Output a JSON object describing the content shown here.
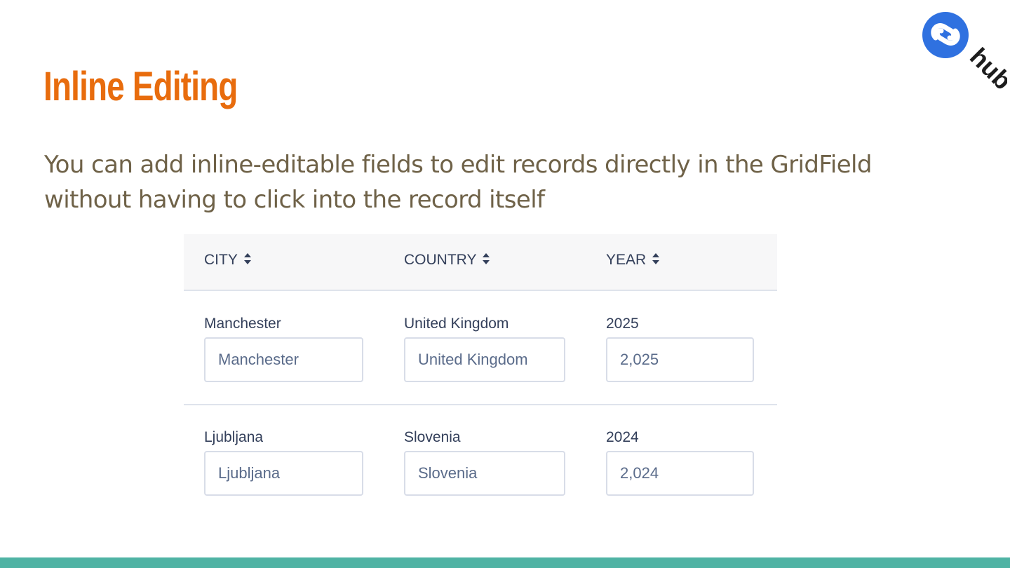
{
  "slide": {
    "title": "Inline Editing",
    "body_line1": "You can add inline-editable fields to edit records directly in the GridField",
    "body_line2": "without having to click into the record itself"
  },
  "logo": {
    "text": "hub",
    "icon": "silverstripe-icon",
    "brand_color": "#2f71e0"
  },
  "grid": {
    "columns": [
      {
        "label": "CITY",
        "icon": "sort-icon"
      },
      {
        "label": "COUNTRY",
        "icon": "sort-icon"
      },
      {
        "label": "YEAR",
        "icon": "sort-icon"
      }
    ],
    "rows": [
      {
        "city_label": "Manchester",
        "city_value": "Manchester",
        "country_label": "United Kingdom",
        "country_value": "United Kingdom",
        "year_label": "2025",
        "year_value": "2,025"
      },
      {
        "city_label": "Ljubljana",
        "city_value": "Ljubljana",
        "country_label": "Slovenia",
        "country_value": "Slovenia",
        "year_label": "2024",
        "year_value": "2,024"
      }
    ]
  },
  "colors": {
    "title": "#e86c0d",
    "body_text": "#6f6248",
    "footer_bar": "#4fb3a4",
    "table_text": "#333f5a"
  }
}
